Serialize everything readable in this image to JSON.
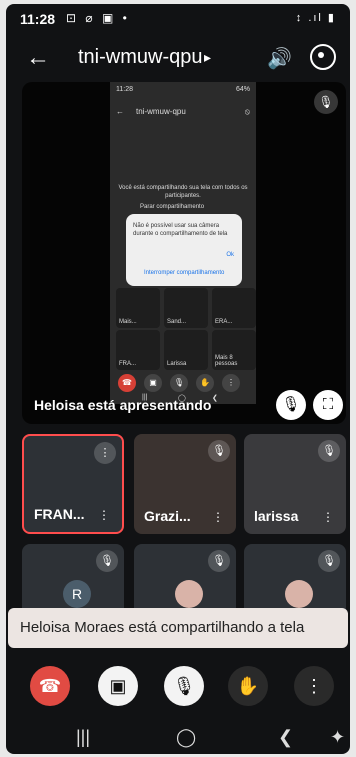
{
  "status_bar": {
    "time": "11:28",
    "left_icons": "⊡ ⌀ ▣ •",
    "right_icons": "↕ .ıl ▮"
  },
  "header": {
    "back_icon": "←",
    "meeting_code": "tni-wmuw-qpu",
    "caret": "▸",
    "speaker_icon": "🔊",
    "camera_flip_icon": "camera-flip-icon"
  },
  "presentation": {
    "label": "Heloisa está apresentando",
    "mic_icon": "🎙",
    "mute_icon": "🎙",
    "fullscreen_icon": "⛶",
    "mini_screen": {
      "status_time": "11:28",
      "status_right": "64%",
      "title": "tni-wmuw-qpu",
      "share_note": "Você está compartilhando sua tela com todos os participantes.",
      "stop_share": "Parar compartilhamento",
      "dialog_message": "Não é possível usar sua câmera durante o compartilhamento de tela",
      "dialog_ok": "Ok",
      "dialog_interrupt": "Interromper compartilhamento",
      "tile_labels": [
        "Mais...",
        "Sand...",
        "ERA...",
        "FRA...",
        "Larissa",
        "Mais 8 pessoas"
      ]
    }
  },
  "participants": [
    {
      "name": "FRAN...",
      "more": "⋮",
      "active": true
    },
    {
      "name": "Grazi...",
      "more": "⋮",
      "active": false
    },
    {
      "name": "larissa",
      "more": "⋮",
      "active": false
    },
    {
      "name": "R",
      "more": "",
      "active": false
    },
    {
      "name": "",
      "more": "",
      "active": false
    },
    {
      "name": "",
      "more": "",
      "active": false
    }
  ],
  "toast": {
    "text": "Heloisa Moraes está compartilhando a tela"
  },
  "controls": {
    "end_call_icon": "☎",
    "camera_off_icon": "▣",
    "mic_off_icon": "🎙",
    "raise_hand_icon": "✋",
    "more_icon": "⋮"
  },
  "navigation": {
    "recent": "|||",
    "home": "◯",
    "back": "❮",
    "accessibility": "✦"
  },
  "colors": {
    "end_call": "#e14b43",
    "active_tile_border": "#ff4d4d",
    "accent": "#1a73e8"
  }
}
